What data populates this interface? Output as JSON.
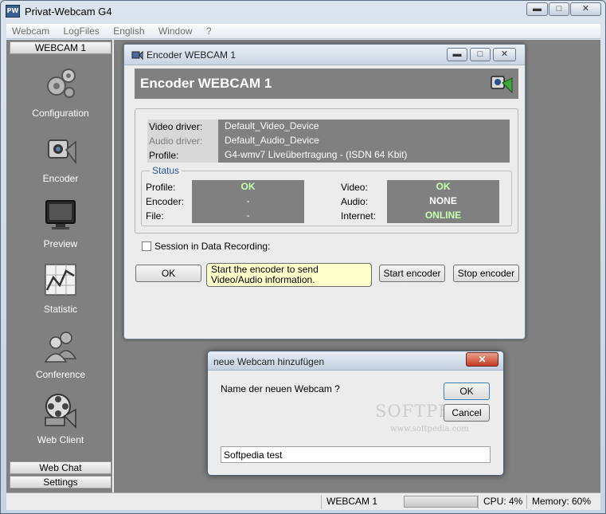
{
  "app": {
    "title": "Privat-Webcam G4",
    "icon_text": "PW"
  },
  "window_buttons": {
    "minimize": "▬",
    "maximize": "□",
    "close": "✕"
  },
  "menu": [
    "Webcam",
    "LogFiles",
    "English",
    "Window",
    "?"
  ],
  "sidebar": {
    "top_tab": "WEBCAM 1",
    "items": [
      {
        "label": "Configuration",
        "icon": "gears-icon"
      },
      {
        "label": "Encoder",
        "icon": "camera-icon"
      },
      {
        "label": "Preview",
        "icon": "monitor-icon"
      },
      {
        "label": "Statistic",
        "icon": "chart-icon"
      },
      {
        "label": "Conference",
        "icon": "people-icon"
      },
      {
        "label": "Web Client",
        "icon": "film-reel-icon"
      }
    ],
    "bottom_tabs": [
      "Web Chat",
      "Settings"
    ]
  },
  "encoder": {
    "window_title": "Encoder WEBCAM 1",
    "header_title": "Encoder WEBCAM 1",
    "info": [
      {
        "label": "Video driver:",
        "value": "Default_Video_Device"
      },
      {
        "label": "Audio driver:",
        "value": "Default_Audio_Device"
      },
      {
        "label": "Profile:",
        "value": "G4-wmv7 Liveübertragung - (ISDN 64 Kbit)"
      }
    ],
    "status_legend": "Status",
    "status_left": [
      {
        "label": "Profile:",
        "value": "OK"
      },
      {
        "label": "Encoder:",
        "value": "-"
      },
      {
        "label": "File:",
        "value": "-"
      }
    ],
    "status_right": [
      {
        "label": "Video:",
        "value": "OK"
      },
      {
        "label": "Audio:",
        "value": "NONE"
      },
      {
        "label": "Internet:",
        "value": "ONLINE"
      }
    ],
    "checkbox_label": "Session in Data Recording:",
    "ok_button": "OK",
    "tooltip": "Start the encoder to send Video/Audio information.",
    "start_button": "Start encoder",
    "stop_button": "Stop encoder"
  },
  "dialog": {
    "title": "neue Webcam hinzufügen",
    "question": "Name der neuen Webcam ?",
    "ok_button": "OK",
    "cancel_button": "Cancel",
    "input_value": "Softpedia test",
    "close": "✕",
    "watermark": "SOFTPEDIA",
    "watermark_url": "www.softpedia.com"
  },
  "statusbar": {
    "webcam": "WEBCAM 1",
    "cpu": "CPU: 4%",
    "memory": "Memory: 60%"
  }
}
